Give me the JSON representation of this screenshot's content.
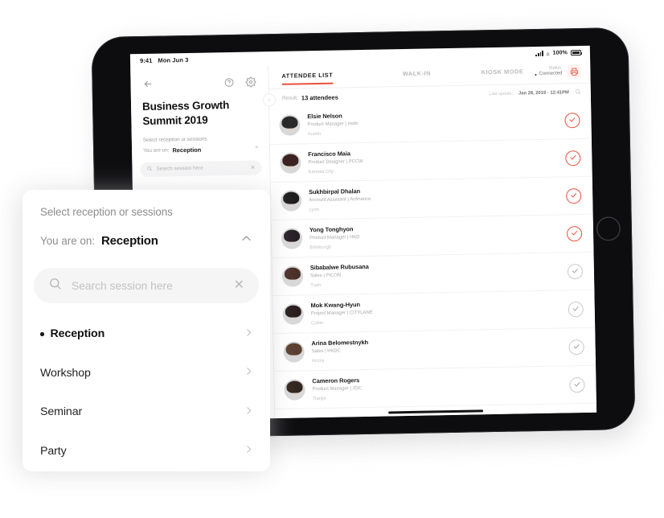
{
  "device": {
    "statusbar": {
      "time": "9:41",
      "date": "Mon Jun 3",
      "battery_pct": "100%",
      "wifi_icon": "wifi-icon",
      "signal_icon": "cellular-signal-icon",
      "battery_icon": "battery-full-icon"
    }
  },
  "left_panel": {
    "back_icon": "arrow-left-icon",
    "help_icon": "help-circle-icon",
    "settings_icon": "gear-icon",
    "event_title": "Business Growth Summit 2019",
    "select_label": "Select reception or sessions",
    "you_are_on_label": "You are on:",
    "you_are_on_value": "Reception",
    "chevron_icon": "chevron-up-icon",
    "search_placeholder": "Search session here",
    "search_icon": "search-icon",
    "clear_icon": "close-icon",
    "sessions": [
      {
        "label": "Reception",
        "active": true
      },
      {
        "label": "Workshop",
        "active": false
      },
      {
        "label": "Seminar",
        "active": false
      }
    ]
  },
  "topbar": {
    "tabs": [
      {
        "label": "ATTENDEE LIST",
        "active": true
      },
      {
        "label": "WALK-IN",
        "active": false
      },
      {
        "label": "KIOSK MODE",
        "active": false
      }
    ],
    "status_label": "Status:",
    "status_value": "Connected",
    "printer_icon": "printer-icon"
  },
  "subbar": {
    "result_label": "Result:",
    "result_value": "13 attendees",
    "last_update_label": "Last update:",
    "last_update_value": "Jan 28, 2019 - 12:41PM",
    "search_icon": "search-icon",
    "collapse_icon": "chevron-left-icon"
  },
  "attendees": [
    {
      "name": "Elsie Nelson",
      "role": "Product Manager | Hsbc",
      "location": "Austin",
      "checked_in": true,
      "hair": "#2a2a2a"
    },
    {
      "name": "Francisco Maia",
      "role": "Product Designer | PCCW",
      "location": "Kansas City",
      "checked_in": true,
      "hair": "#3a2320"
    },
    {
      "name": "Sukhbirpal Dhalan",
      "role": "Account Assistant | Airfinance",
      "location": "Lyon",
      "checked_in": true,
      "hair": "#1e1e1e"
    },
    {
      "name": "Yong Tonghyon",
      "role": "Product Manager | HKD",
      "location": "Edinburgh",
      "checked_in": true,
      "hair": "#262026"
    },
    {
      "name": "Sibabalwe Rubusana",
      "role": "Sales | PICON",
      "location": "Turin",
      "checked_in": false,
      "hair": "#4a3028"
    },
    {
      "name": "Mok Kwang-Hyun",
      "role": "Project Manager | CITYLANE",
      "location": "Colon",
      "checked_in": false,
      "hair": "#2b1d1d"
    },
    {
      "name": "Arina Belomestnykh",
      "role": "Sales | HKDC",
      "location": "Accra",
      "checked_in": false,
      "hair": "#5a4030"
    },
    {
      "name": "Cameron Rogers",
      "role": "Product Manager | JDC",
      "location": "Tianjin",
      "checked_in": false,
      "hair": "#33261f"
    }
  ],
  "overlay": {
    "title": "Select reception or sessions",
    "you_are_on_label": "You are on:",
    "you_are_on_value": "Reception",
    "collapse_icon": "chevron-up-icon",
    "search_placeholder": "Search session here",
    "search_value": "",
    "search_icon": "search-icon",
    "clear_icon": "close-icon",
    "sessions": [
      {
        "label": "Reception",
        "active": true
      },
      {
        "label": "Workshop",
        "active": false
      },
      {
        "label": "Seminar",
        "active": false
      },
      {
        "label": "Party",
        "active": false
      }
    ]
  },
  "colors": {
    "accent": "#e8503a",
    "text": "#161616",
    "muted": "#a8a8a8",
    "device": "#0d0d0f"
  }
}
